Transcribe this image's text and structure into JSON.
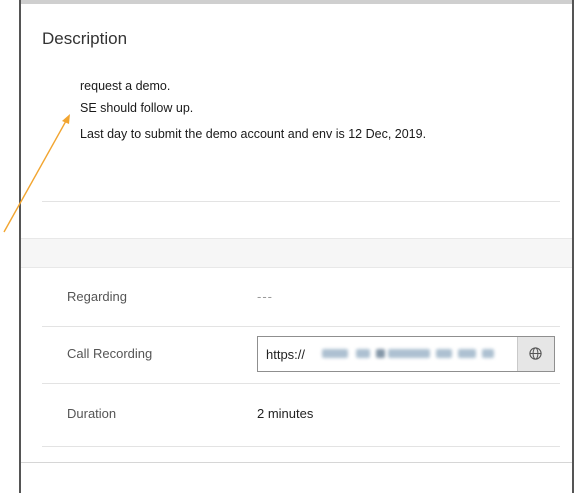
{
  "description": {
    "title": "Description",
    "lines": [
      "request a demo.",
      "SE should follow up.",
      "Last day to submit the demo account and env is 12 Dec, 2019."
    ]
  },
  "fields": {
    "regarding": {
      "label": "Regarding",
      "value": "---"
    },
    "call_recording": {
      "label": "Call Recording",
      "value": "https://"
    },
    "duration": {
      "label": "Duration",
      "value": "2 minutes"
    }
  },
  "icons": {
    "open_link": "globe-icon"
  },
  "colors": {
    "annotation_arrow": "#f2a530",
    "frame": "#555555"
  }
}
